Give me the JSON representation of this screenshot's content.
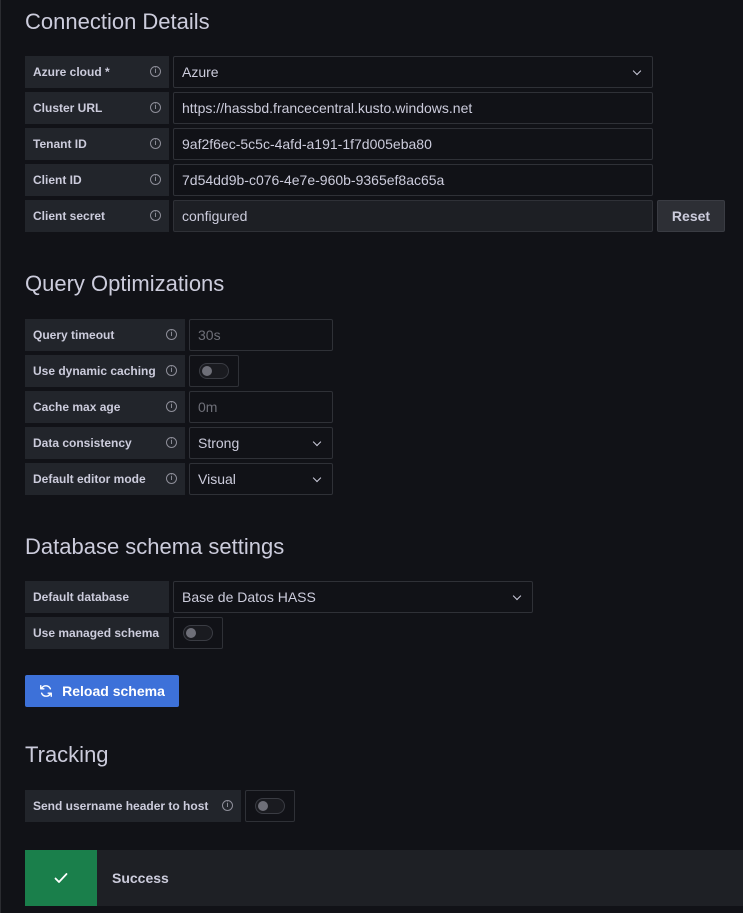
{
  "connection": {
    "title": "Connection Details",
    "fields": [
      {
        "label": "Azure cloud *",
        "value": "Azure"
      },
      {
        "label": "Cluster URL",
        "value": "https://hassbd.francecentral.kusto.windows.net"
      },
      {
        "label": "Tenant ID",
        "value": "9af2f6ec-5c5c-4afd-a191-1f7d005eba80"
      },
      {
        "label": "Client ID",
        "value": "7d54dd9b-c076-4e7e-960b-9365ef8ac65a"
      },
      {
        "label": "Client secret",
        "value": "configured"
      }
    ],
    "reset_label": "Reset"
  },
  "query": {
    "title": "Query Optimizations",
    "fields": [
      {
        "label": "Query timeout",
        "placeholder": "30s"
      },
      {
        "label": "Use dynamic caching",
        "enabled": false
      },
      {
        "label": "Cache max age",
        "placeholder": "0m"
      },
      {
        "label": "Data consistency",
        "value": "Strong"
      },
      {
        "label": "Default editor mode",
        "value": "Visual"
      }
    ]
  },
  "schema": {
    "title": "Database schema settings",
    "fields": [
      {
        "label": "Default database",
        "value": "Base de Datos HASS"
      },
      {
        "label": "Use managed schema",
        "enabled": false
      }
    ],
    "reload_label": "Reload schema"
  },
  "tracking": {
    "title": "Tracking",
    "fields": [
      {
        "label": "Send username header to host",
        "enabled": false
      }
    ]
  },
  "alert": {
    "message": "Success",
    "status": "success",
    "color": "#1a7f4b"
  },
  "icons": {
    "info": "info-circle-icon",
    "chevron": "chevron-down-icon",
    "reload": "sync-icon",
    "check": "check-icon"
  },
  "colors": {
    "primary": "#3d71d9",
    "background": "#111217",
    "label_bg": "#22252b"
  }
}
